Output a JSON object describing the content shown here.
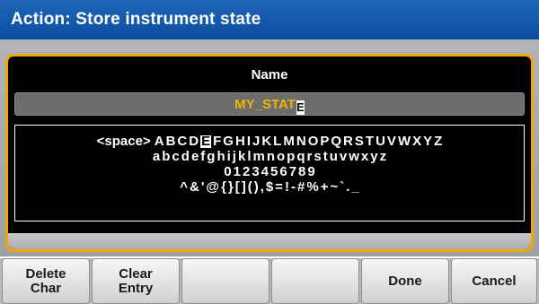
{
  "title": "Action: Store instrument state",
  "dialog": {
    "name_label": "Name",
    "input_value": "MY_STAT",
    "cursor_char": "E",
    "keyboard": {
      "rows": [
        [
          "<space>",
          "A",
          "B",
          "C",
          "D",
          "E",
          "F",
          "G",
          "H",
          "I",
          "J",
          "K",
          "L",
          "M",
          "N",
          "O",
          "P",
          "Q",
          "R",
          "S",
          "T",
          "U",
          "V",
          "W",
          "X",
          "Y",
          "Z"
        ],
        [
          "a",
          "b",
          "c",
          "d",
          "e",
          "f",
          "g",
          "h",
          "i",
          "j",
          "k",
          "l",
          "m",
          "n",
          "o",
          "p",
          "q",
          "r",
          "s",
          "t",
          "u",
          "v",
          "w",
          "x",
          "y",
          "z"
        ],
        [
          "0",
          "1",
          "2",
          "3",
          "4",
          "5",
          "6",
          "7",
          "8",
          "9"
        ],
        [
          "^",
          "&",
          "'",
          "@",
          "{",
          "}",
          "[",
          "]",
          "(",
          ")",
          ",",
          "$",
          "=",
          "!",
          "-",
          "#",
          "%",
          "+",
          "~",
          "`",
          ".",
          "_"
        ]
      ],
      "selected_key": "E"
    }
  },
  "softkeys": [
    "Delete\nChar",
    "Clear\nEntry",
    "",
    "",
    "Done",
    "Cancel"
  ],
  "colors": {
    "title_bar": "#0b4d9e",
    "dialog_border": "#f2a800",
    "input_text": "#f0b400"
  }
}
